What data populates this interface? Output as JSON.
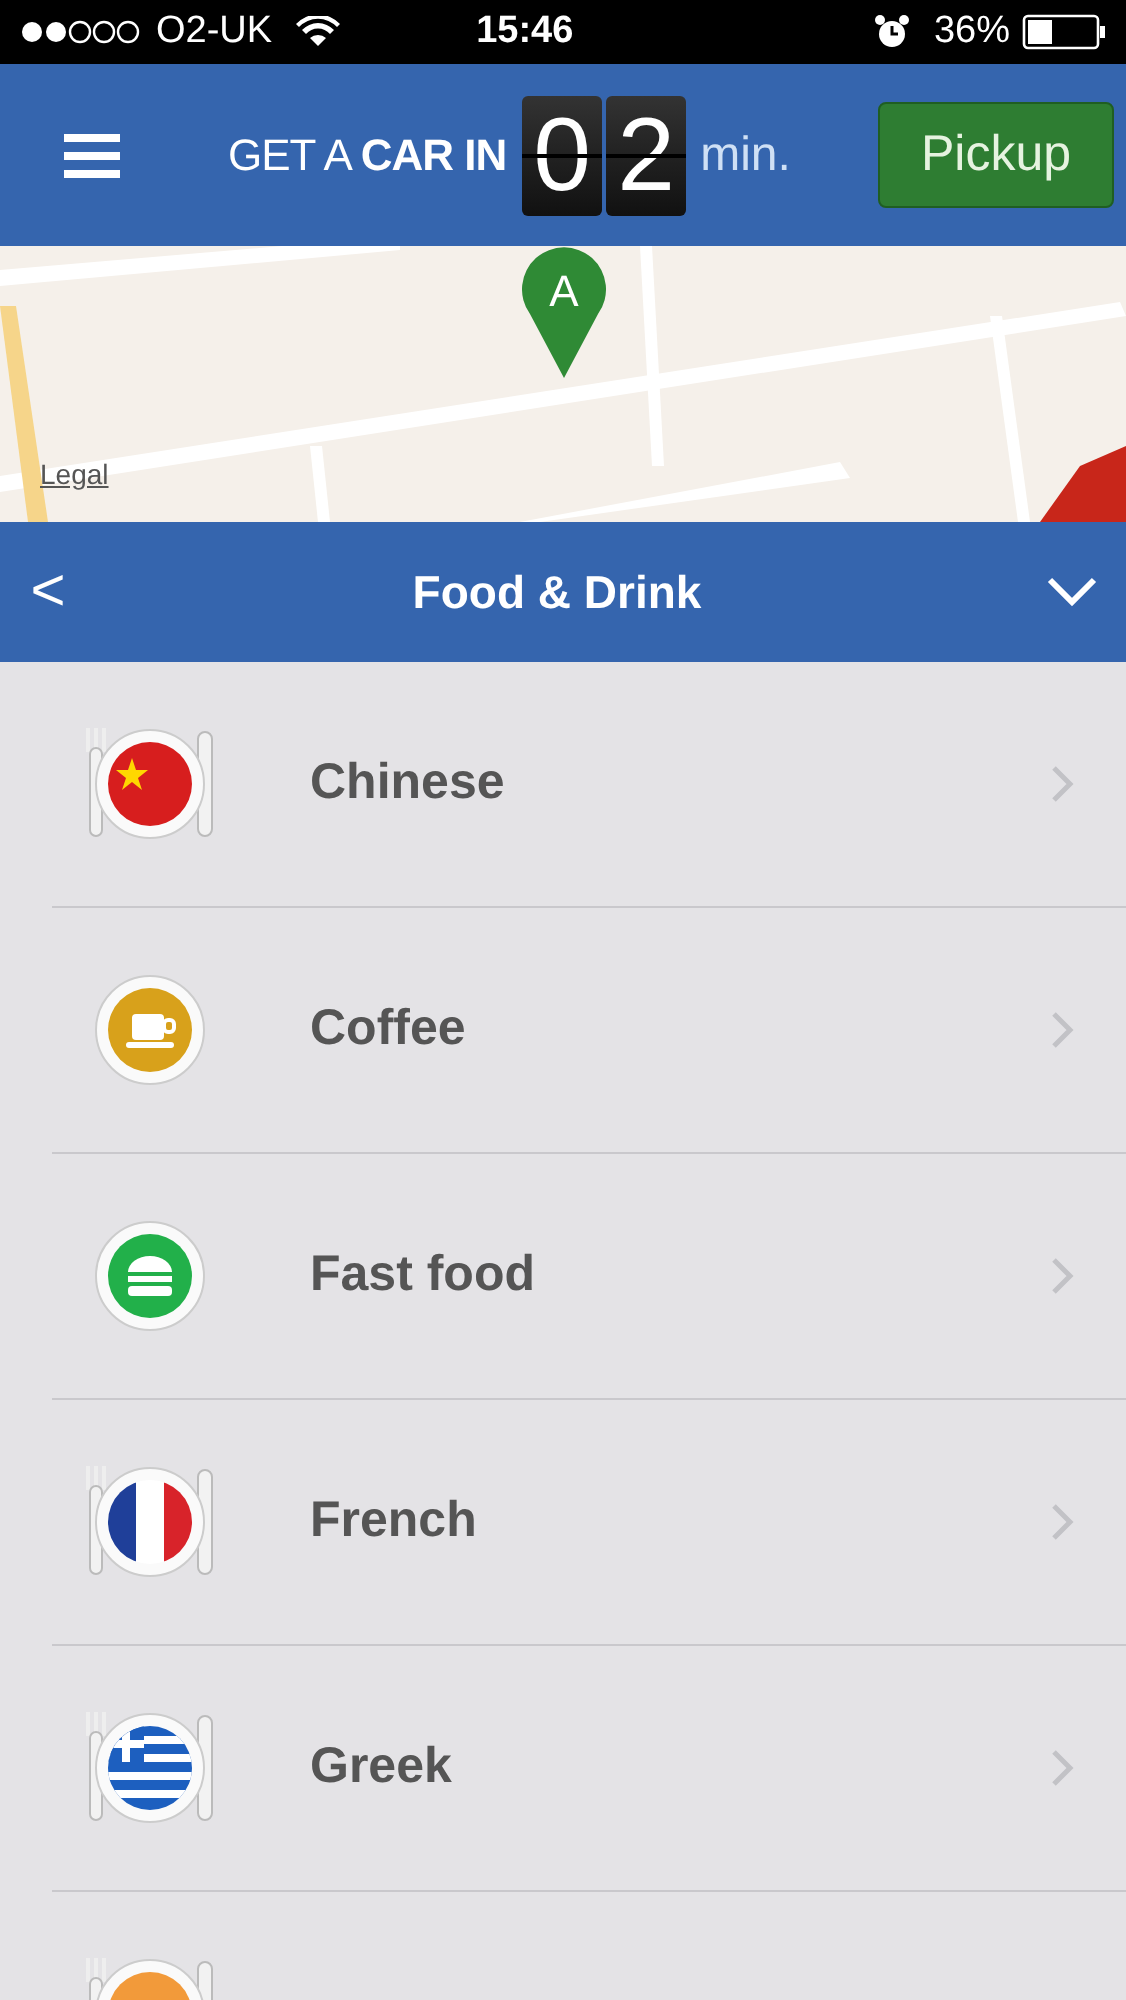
{
  "status_bar": {
    "carrier": "O2-UK",
    "time": "15:46",
    "battery": "36%"
  },
  "header": {
    "tagline": "GET A **CAR IN**",
    "digits": [
      "0",
      "2"
    ],
    "unit": "min.",
    "button": "Pickup"
  },
  "map": {
    "kind": "picture",
    "pin": "A",
    "legal": "Legal"
  },
  "category_bar": {
    "back": "<",
    "title": "Food & Drink"
  },
  "items": [
    {
      "kind": "china",
      "label": "Chinese"
    },
    {
      "kind": "coffee",
      "label": "Coffee"
    },
    {
      "kind": "burger",
      "label": "Fast food"
    },
    {
      "kind": "france",
      "label": "French"
    },
    {
      "kind": "greece",
      "label": "Greek"
    },
    {
      "kind": "india"
    }
  ]
}
